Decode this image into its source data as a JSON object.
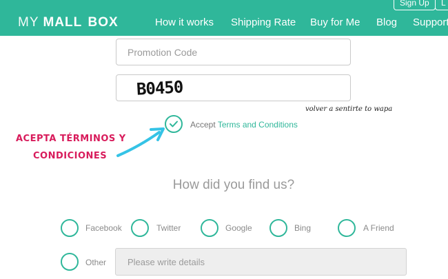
{
  "header": {
    "logo": {
      "part1": "MY",
      "part2": "MALL",
      "part3": "BOX"
    },
    "nav": [
      "How it works",
      "Shipping Rate",
      "Buy for Me",
      "Blog",
      "Support"
    ],
    "signup_label": "Sign Up",
    "login_label": "L"
  },
  "form": {
    "promo_placeholder": "Promotion Code",
    "captcha_text": "B0450",
    "accept_label": "Accept",
    "terms_link": "Terms and Conditions"
  },
  "overlay": {
    "note": "volver a sentirte to wapa",
    "annotation_line1": "ACEPTA TÉRMINOS Y",
    "annotation_line2": "CONDICIONES"
  },
  "survey": {
    "question": "How did you find us?",
    "options": [
      "Facebook",
      "Twitter",
      "Google",
      "Bing",
      "A Friend",
      "Other"
    ],
    "details_placeholder": "Please write details"
  },
  "colors": {
    "accent": "#2fb79a",
    "annotation": "#d81b5b"
  }
}
